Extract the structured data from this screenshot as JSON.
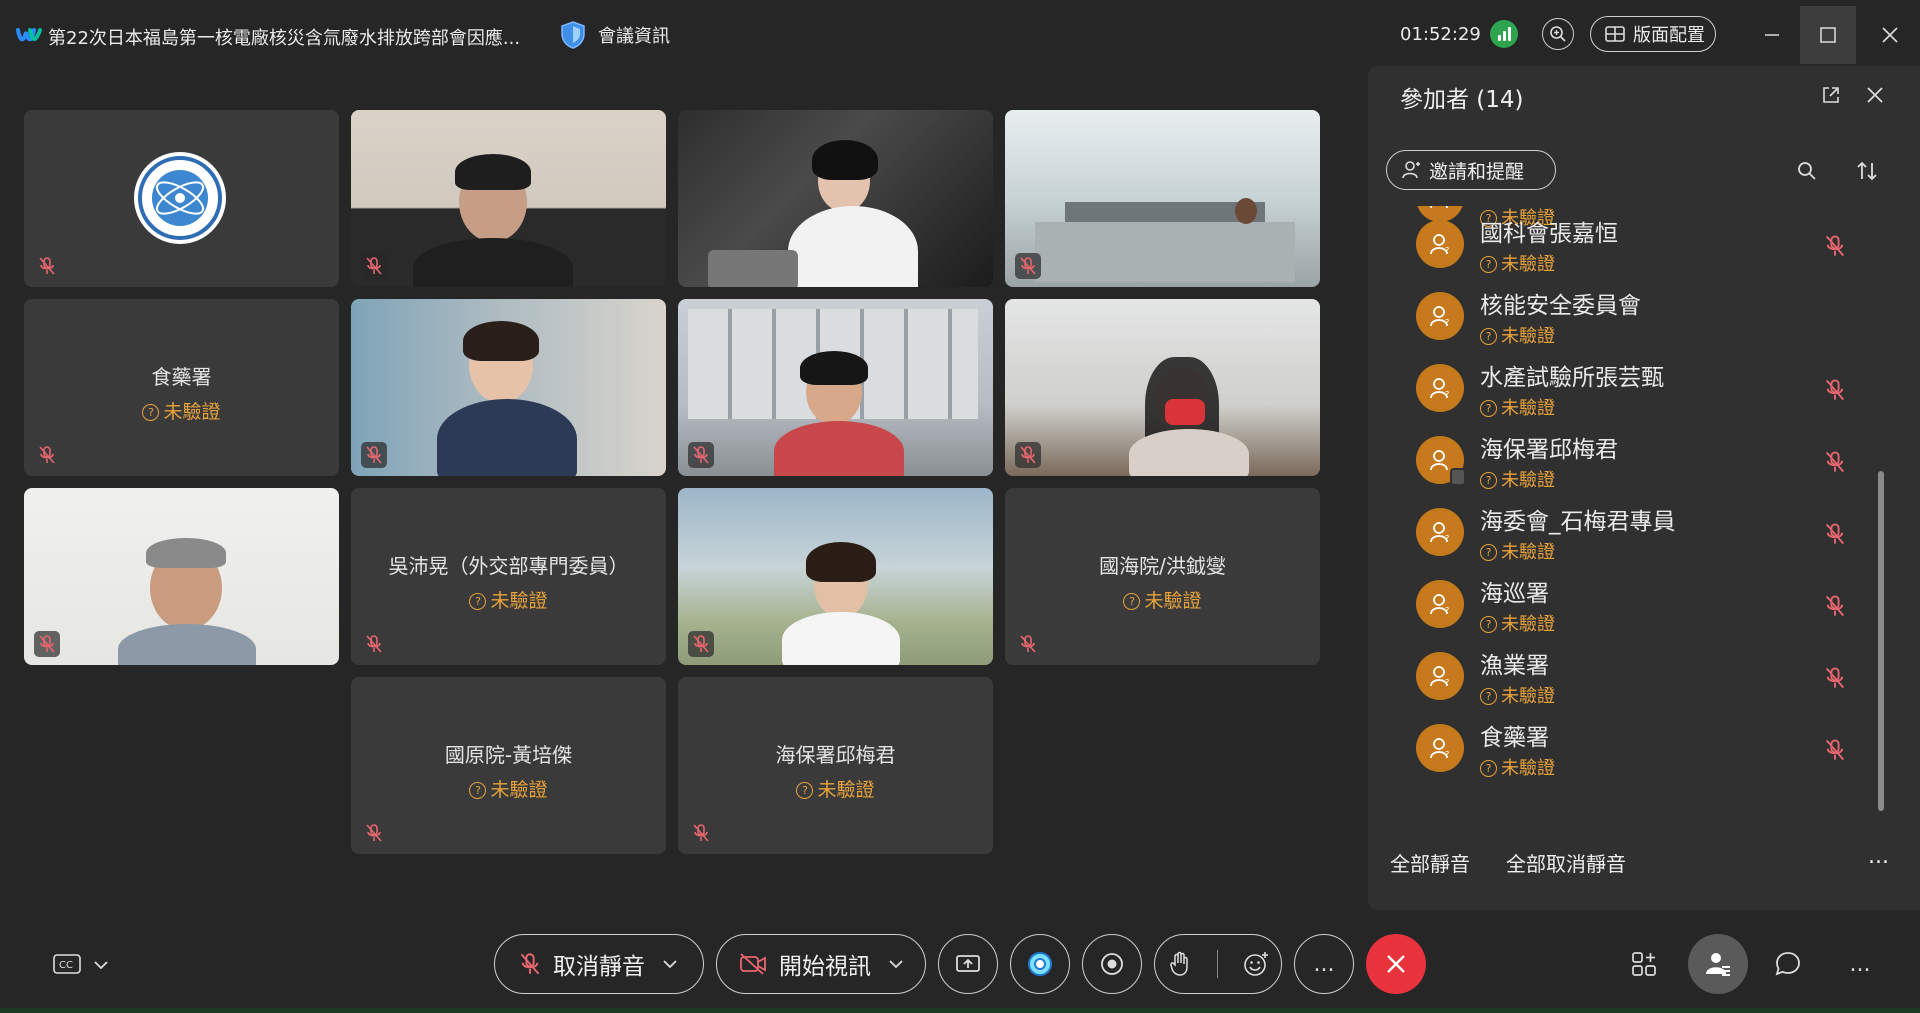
{
  "title_bar": {
    "meeting_title": "第22次日本福島第一核電廠核災含氚廢水排放跨部會因應...",
    "info_label": "會議資訊",
    "timer": "01:52:29",
    "layout_label": "版面配置"
  },
  "video_tiles": [
    {
      "id": "t1",
      "type": "logo",
      "name": "",
      "status": ""
    },
    {
      "id": "t2",
      "type": "video",
      "name": "",
      "status": ""
    },
    {
      "id": "t3",
      "type": "video",
      "name": "",
      "status": ""
    },
    {
      "id": "t4",
      "type": "video",
      "name": "",
      "status": ""
    },
    {
      "id": "t5",
      "type": "name",
      "name": "食藥署",
      "status": "未驗證"
    },
    {
      "id": "t6",
      "type": "video",
      "name": "",
      "status": ""
    },
    {
      "id": "t7",
      "type": "video",
      "name": "",
      "status": ""
    },
    {
      "id": "t8",
      "type": "video",
      "name": "",
      "status": ""
    },
    {
      "id": "t9",
      "type": "video",
      "name": "",
      "status": ""
    },
    {
      "id": "t10",
      "type": "name",
      "name": "吳沛晃（外交部專門委員）",
      "status": "未驗證"
    },
    {
      "id": "t11",
      "type": "video",
      "name": "",
      "status": ""
    },
    {
      "id": "t12",
      "type": "name",
      "name": "國海院/洪鉞燮",
      "status": "未驗證"
    },
    {
      "id": "t13",
      "type": "name",
      "name": "國原院-黃培傑",
      "status": "未驗證"
    },
    {
      "id": "t14",
      "type": "name",
      "name": "海保署邱梅君",
      "status": "未驗證"
    }
  ],
  "participants_panel": {
    "title": "參加者 (14)",
    "invite_label": "邀請和提醒",
    "participants": [
      {
        "name": "",
        "status": "未驗證"
      },
      {
        "name": "國科會張嘉恒",
        "status": "未驗證"
      },
      {
        "name": "核能安全委員會",
        "status": "未驗證"
      },
      {
        "name": "水產試驗所張芸甄",
        "status": "未驗證"
      },
      {
        "name": "海保署邱梅君",
        "status": "未驗證"
      },
      {
        "name": "海委會_石梅君專員",
        "status": "未驗證"
      },
      {
        "name": "海巡署",
        "status": "未驗證"
      },
      {
        "name": "漁業署",
        "status": "未驗證"
      },
      {
        "name": "食藥署",
        "status": "未驗證"
      }
    ],
    "mute_all_label": "全部靜音",
    "unmute_all_label": "全部取消靜音",
    "more_label": "..."
  },
  "toolbar": {
    "unmute_label": "取消靜音",
    "start_video_label": "開始視訊",
    "more_label": "...",
    "colors": {
      "end_call": "#e8323c",
      "accent_orange": "#c77a1d",
      "status_orange": "#e7a23a",
      "mute_red": "#e8666f"
    }
  }
}
